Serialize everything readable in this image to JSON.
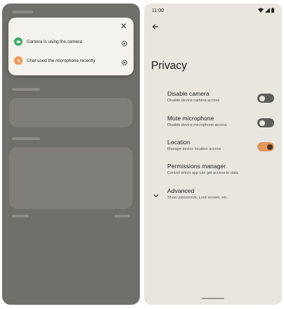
{
  "left_screen": {
    "popup": {
      "items": [
        {
          "label": "Camera is using the camera",
          "icon": "camera-icon",
          "color": "#3fa86b"
        },
        {
          "label": "Chat used the microphone recently",
          "icon": "microphone-icon",
          "color": "#f29552"
        }
      ]
    }
  },
  "right_screen": {
    "status_bar": {
      "time": "11:00"
    },
    "title": "Privacy",
    "settings": [
      {
        "title": "Disable camera",
        "subtitle": "Disable device camera access",
        "toggle": "off"
      },
      {
        "title": "Mute microphone",
        "subtitle": "Disable device microphone access",
        "toggle": "off"
      },
      {
        "title": "Location",
        "subtitle": "Manage device location access",
        "toggle": "on"
      },
      {
        "title": "Permissions manager",
        "subtitle": "Control which app can get access to data"
      },
      {
        "title": "Advanced",
        "subtitle": "Show passwords, Lock screen, etc."
      }
    ],
    "colors": {
      "toggle_on": "#e3955a",
      "toggle_off": "#5f5e5a"
    }
  }
}
